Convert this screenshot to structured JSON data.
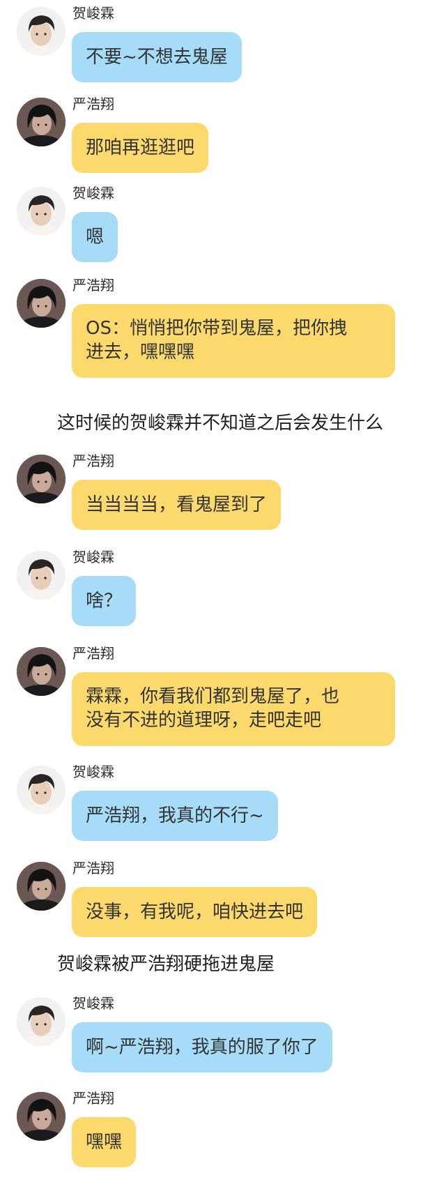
{
  "senders": {
    "he": "贺峻霖",
    "yan": "严浩翔"
  },
  "colors": {
    "he_bubble": "#a6dcf7",
    "yan_bubble": "#fcd96c"
  },
  "messages": [
    {
      "sender": "贺峻霖",
      "text": "不要~不想去鬼屋"
    },
    {
      "sender": "严浩翔",
      "text": "那咱再逛逛吧"
    },
    {
      "sender": "贺峻霖",
      "text": "嗯"
    },
    {
      "sender": "严浩翔",
      "line1": "OS：悄悄把你带到鬼屋，把你拽",
      "line2": "进去，嘿嘿嘿"
    },
    {
      "narration": "这时候的贺峻霖并不知道之后会发生什么"
    },
    {
      "sender": "严浩翔",
      "text": "当当当当，看鬼屋到了"
    },
    {
      "sender": "贺峻霖",
      "text": "啥？"
    },
    {
      "sender": "严浩翔",
      "line1": "霖霖，你看我们都到鬼屋了，也",
      "line2": "没有不进的道理呀，走吧走吧"
    },
    {
      "sender": "贺峻霖",
      "text": "严浩翔，我真的不行~"
    },
    {
      "sender": "严浩翔",
      "text": "没事，有我呢，咱快进去吧"
    },
    {
      "narration": "贺峻霖被严浩翔硬拖进鬼屋"
    },
    {
      "sender": "贺峻霖",
      "text": "啊~严浩翔，我真的服了你了"
    },
    {
      "sender": "严浩翔",
      "text": "嘿嘿"
    }
  ]
}
